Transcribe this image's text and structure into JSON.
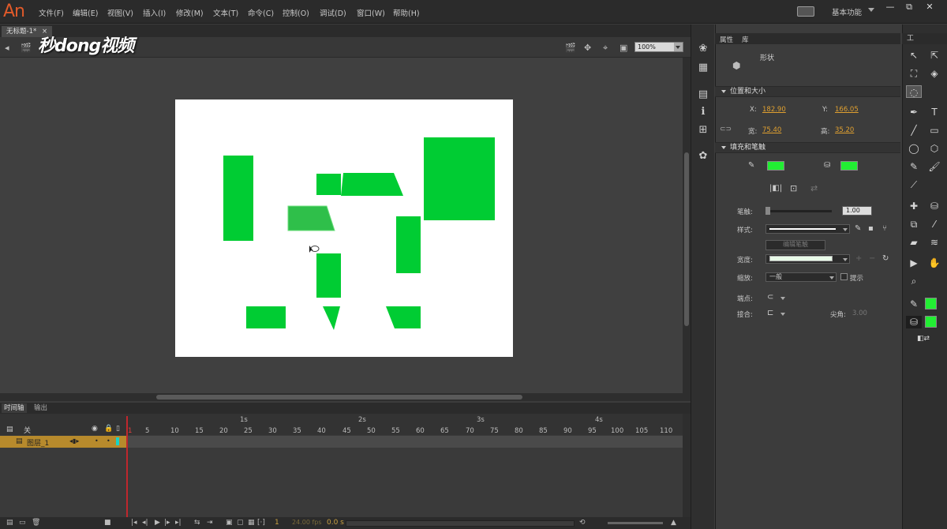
{
  "app": {
    "logo": "An"
  },
  "menu": [
    "文件(F)",
    "编辑(E)",
    "视图(V)",
    "插入(I)",
    "修改(M)",
    "文本(T)",
    "命令(C)",
    "控制(O)",
    "调试(D)",
    "窗口(W)",
    "帮助(H)"
  ],
  "workspace_label": "基本功能",
  "window_buttons": [
    "—",
    "⧉",
    "✕"
  ],
  "document": {
    "tab_label": "无标题-1*",
    "close": "×"
  },
  "watermark": "秒dong视频",
  "zoom": "100%",
  "colors": {
    "shape_fill": "#00cc33",
    "fill_swatch": "#22ee33",
    "layer_highlight": "#b78a2c",
    "playhead": "#c0272d"
  },
  "timeline": {
    "tabs": [
      "时间轴",
      "输出"
    ],
    "layer_header": "关",
    "layer_name": "图层_1",
    "seconds": [
      "1s",
      "2s",
      "3s",
      "4s"
    ],
    "ticks": [
      "1",
      "5",
      "10",
      "15",
      "20",
      "25",
      "30",
      "35",
      "40",
      "45",
      "50",
      "55",
      "60",
      "65",
      "70",
      "75",
      "80",
      "85",
      "90",
      "95",
      "100",
      "105",
      "110"
    ],
    "current_frame": "1",
    "fps": "24.00 fps",
    "time": "0.0 s"
  },
  "properties": {
    "tabs": [
      "属性",
      "库"
    ],
    "title": "形状",
    "section_position": "位置和大小",
    "x_label": "X:",
    "x_value": "182.90",
    "y_label": "Y:",
    "y_value": "166.05",
    "w_label": "宽:",
    "w_value": "75.40",
    "h_label": "高:",
    "h_value": "35.20",
    "section_fill": "填充和笔触",
    "stroke_label": "笔触:",
    "stroke_value": "1.00",
    "style_label": "样式:",
    "edit_style": "编辑笔触",
    "width_label": "宽度:",
    "scale_label": "缩放:",
    "scale_value": "一般",
    "hint_label": "提示",
    "cap_label": "端点:",
    "join_label": "接合:",
    "miter_label": "尖角:",
    "miter_value": "3.00"
  },
  "tools_header": "工"
}
